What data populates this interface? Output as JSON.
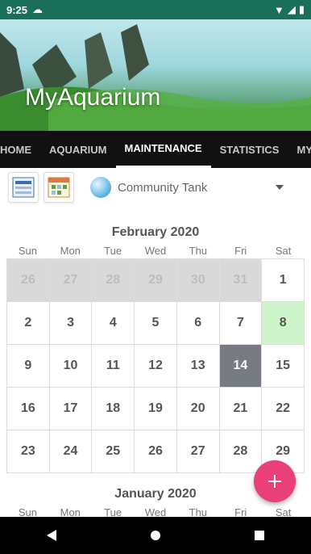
{
  "status_bar": {
    "time": "9:25"
  },
  "header": {
    "title": "MyAquarium"
  },
  "tabs": [
    {
      "label": "HOME"
    },
    {
      "label": "AQUARIUM"
    },
    {
      "label": "MAINTENANCE"
    },
    {
      "label": "STATISTICS"
    },
    {
      "label": "MY L"
    }
  ],
  "toolbar": {
    "tank_name": "Community Tank"
  },
  "calendar": {
    "month_title": "February 2020",
    "weekdays": [
      "Sun",
      "Mon",
      "Tue",
      "Wed",
      "Thu",
      "Fri",
      "Sat"
    ],
    "rows": [
      [
        {
          "d": "26",
          "s": "outside"
        },
        {
          "d": "27",
          "s": "outside"
        },
        {
          "d": "28",
          "s": "outside"
        },
        {
          "d": "29",
          "s": "outside"
        },
        {
          "d": "30",
          "s": "outside"
        },
        {
          "d": "31",
          "s": "outside"
        },
        {
          "d": "1",
          "s": ""
        }
      ],
      [
        {
          "d": "2",
          "s": ""
        },
        {
          "d": "3",
          "s": ""
        },
        {
          "d": "4",
          "s": ""
        },
        {
          "d": "5",
          "s": ""
        },
        {
          "d": "6",
          "s": ""
        },
        {
          "d": "7",
          "s": ""
        },
        {
          "d": "8",
          "s": "highlight"
        }
      ],
      [
        {
          "d": "9",
          "s": ""
        },
        {
          "d": "10",
          "s": ""
        },
        {
          "d": "11",
          "s": ""
        },
        {
          "d": "12",
          "s": ""
        },
        {
          "d": "13",
          "s": ""
        },
        {
          "d": "14",
          "s": "selected"
        },
        {
          "d": "15",
          "s": ""
        }
      ],
      [
        {
          "d": "16",
          "s": ""
        },
        {
          "d": "17",
          "s": ""
        },
        {
          "d": "18",
          "s": ""
        },
        {
          "d": "19",
          "s": ""
        },
        {
          "d": "20",
          "s": ""
        },
        {
          "d": "21",
          "s": ""
        },
        {
          "d": "22",
          "s": ""
        }
      ],
      [
        {
          "d": "23",
          "s": ""
        },
        {
          "d": "24",
          "s": ""
        },
        {
          "d": "25",
          "s": ""
        },
        {
          "d": "26",
          "s": ""
        },
        {
          "d": "27",
          "s": ""
        },
        {
          "d": "28",
          "s": ""
        },
        {
          "d": "29",
          "s": ""
        }
      ]
    ],
    "next_month_title": "January 2020",
    "next_weekdays": [
      "Sun",
      "Mon",
      "Tue",
      "Wed",
      "Thu",
      "Fri",
      "Sat"
    ]
  },
  "colors": {
    "accent": "#e94078",
    "selected_day": "#777b82",
    "highlight_day": "#ccf5cc",
    "outside_day": "#d9d9d9"
  }
}
